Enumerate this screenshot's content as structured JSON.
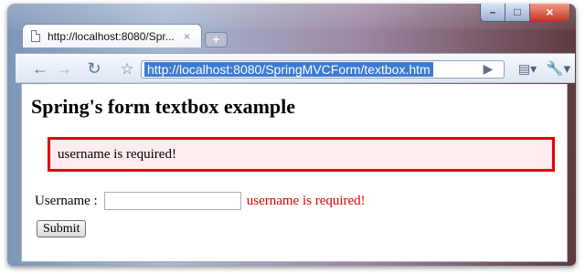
{
  "browser": {
    "tab": {
      "title": "http://localhost:8080/Spr...",
      "close": "×"
    },
    "new_tab": "+",
    "window_controls": {
      "minimize": "–",
      "maximize": "□",
      "close": "×"
    },
    "toolbar": {
      "back_icon": "←",
      "forward_icon": "→",
      "reload_icon": "↻",
      "star_icon": "☆",
      "go_icon": "▶",
      "page_menu_icon": "▤▾",
      "wrench_icon": "🔧▾",
      "address": "http://localhost:8080/SpringMVCForm/textbox.htm"
    }
  },
  "page": {
    "heading": "Spring's form textbox example",
    "error_summary": "username is required!",
    "form": {
      "username_label": "Username :",
      "username_value": "",
      "username_error": "username is required!",
      "submit_label": "Submit"
    }
  },
  "colors": {
    "error_red": "#e60000",
    "error_background": "#ffecef",
    "selection_blue": "#3a7bd5"
  }
}
